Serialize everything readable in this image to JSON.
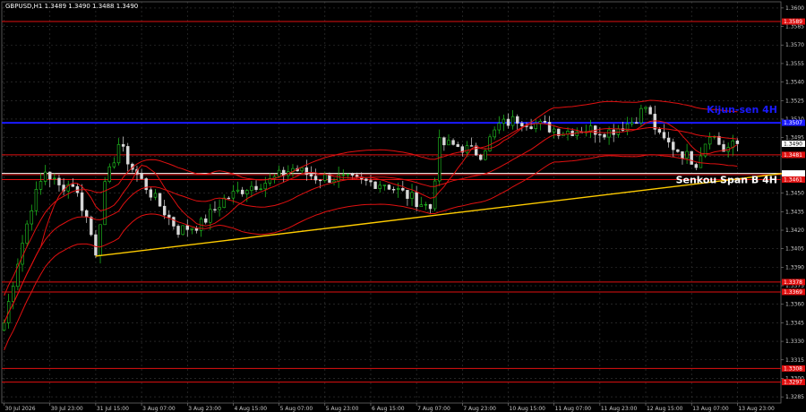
{
  "chart_data": {
    "type": "candlestick",
    "title": "GBPUSD,H1  1.3489 1.3490 1.3488 1.3490",
    "ylim": [
      1.328,
      1.3605
    ],
    "y_ticks": [
      "1.3600",
      "1.3585",
      "1.3570",
      "1.3555",
      "1.3540",
      "1.3525",
      "1.3510",
      "1.3495",
      "1.3480",
      "1.3465",
      "1.3450",
      "1.3435",
      "1.3420",
      "1.3405",
      "1.3390",
      "1.3375",
      "1.3360",
      "1.3345",
      "1.3330",
      "1.3315",
      "1.3300",
      "1.3285"
    ],
    "x_ticks": [
      {
        "i": 0,
        "label": "30 Jul 2026"
      },
      {
        "i": 10,
        "label": "30 Jul 23:00"
      },
      {
        "i": 20,
        "label": "31 Jul 15:00"
      },
      {
        "i": 30,
        "label": "3 Aug 07:00"
      },
      {
        "i": 40,
        "label": "3 Aug 23:00"
      },
      {
        "i": 50,
        "label": "4 Aug 15:00"
      },
      {
        "i": 60,
        "label": "5 Aug 07:00"
      },
      {
        "i": 70,
        "label": "5 Aug 23:00"
      },
      {
        "i": 80,
        "label": "6 Aug 15:00"
      },
      {
        "i": 90,
        "label": "7 Aug 07:00"
      },
      {
        "i": 100,
        "label": "7 Aug 23:00"
      },
      {
        "i": 110,
        "label": "10 Aug 15:00"
      },
      {
        "i": 120,
        "label": "11 Aug 07:00"
      },
      {
        "i": 130,
        "label": "11 Aug 23:00"
      },
      {
        "i": 140,
        "label": "12 Aug 15:00"
      },
      {
        "i": 150,
        "label": "13 Aug 07:00"
      },
      {
        "i": 160,
        "label": "13 Aug 23:00"
      }
    ],
    "current_price": "1.3490",
    "levels": [
      {
        "price": 1.3589,
        "label": "1.3589",
        "color": "#e01010"
      },
      {
        "price": 1.3507,
        "label": "1.3507",
        "color": "#1a1aff"
      },
      {
        "price": 1.3481,
        "label": "1.3481",
        "color": "#e01010"
      },
      {
        "price": 1.3465,
        "label": "1.3465",
        "color": "#e01010"
      },
      {
        "price": 1.3466,
        "label": "1.3466",
        "color": "#ffffff"
      },
      {
        "price": 1.3461,
        "label": "1.3461",
        "color": "#e01010"
      },
      {
        "price": 1.3378,
        "label": "1.3378",
        "color": "#e01010"
      },
      {
        "price": 1.337,
        "label": "1.3369",
        "color": "#e01010"
      },
      {
        "price": 1.3308,
        "label": "1.3308",
        "color": "#e01010"
      },
      {
        "price": 1.3297,
        "label": "1.3297",
        "color": "#e01010"
      }
    ],
    "annotations": [
      {
        "text": "Kijun-sen 4H",
        "price": 1.3515,
        "color": "#1a1aff"
      },
      {
        "text": "Senkou Span B 4H",
        "price": 1.3458,
        "color": "#ffffff"
      }
    ],
    "trendline": {
      "start": {
        "i": 20,
        "price": 1.3399
      },
      "end": {
        "i": 170,
        "price": 1.3466
      },
      "color": "#ffcc00"
    },
    "anchors": [
      {
        "i": 0,
        "price": 1.3345
      },
      {
        "i": 3,
        "price": 1.3395
      },
      {
        "i": 6,
        "price": 1.344
      },
      {
        "i": 9,
        "price": 1.3468
      },
      {
        "i": 12,
        "price": 1.3455
      },
      {
        "i": 15,
        "price": 1.3458
      },
      {
        "i": 18,
        "price": 1.343
      },
      {
        "i": 20,
        "price": 1.3403
      },
      {
        "i": 22,
        "price": 1.3455
      },
      {
        "i": 25,
        "price": 1.349
      },
      {
        "i": 28,
        "price": 1.347
      },
      {
        "i": 31,
        "price": 1.3455
      },
      {
        "i": 34,
        "price": 1.344
      },
      {
        "i": 38,
        "price": 1.342
      },
      {
        "i": 43,
        "price": 1.3425
      },
      {
        "i": 48,
        "price": 1.3445
      },
      {
        "i": 53,
        "price": 1.3455
      },
      {
        "i": 58,
        "price": 1.346
      },
      {
        "i": 63,
        "price": 1.347
      },
      {
        "i": 68,
        "price": 1.3463
      },
      {
        "i": 73,
        "price": 1.3462
      },
      {
        "i": 78,
        "price": 1.3459
      },
      {
        "i": 83,
        "price": 1.3458
      },
      {
        "i": 88,
        "price": 1.3448
      },
      {
        "i": 93,
        "price": 1.3438
      },
      {
        "i": 95,
        "price": 1.349
      },
      {
        "i": 99,
        "price": 1.3488
      },
      {
        "i": 104,
        "price": 1.3482
      },
      {
        "i": 108,
        "price": 1.3505
      },
      {
        "i": 112,
        "price": 1.351
      },
      {
        "i": 117,
        "price": 1.3505
      },
      {
        "i": 122,
        "price": 1.35
      },
      {
        "i": 127,
        "price": 1.3502
      },
      {
        "i": 132,
        "price": 1.35
      },
      {
        "i": 137,
        "price": 1.3508
      },
      {
        "i": 140,
        "price": 1.352
      },
      {
        "i": 143,
        "price": 1.3495
      },
      {
        "i": 147,
        "price": 1.3485
      },
      {
        "i": 151,
        "price": 1.3475
      },
      {
        "i": 154,
        "price": 1.35
      },
      {
        "i": 157,
        "price": 1.3485
      },
      {
        "i": 160,
        "price": 1.349
      }
    ]
  }
}
